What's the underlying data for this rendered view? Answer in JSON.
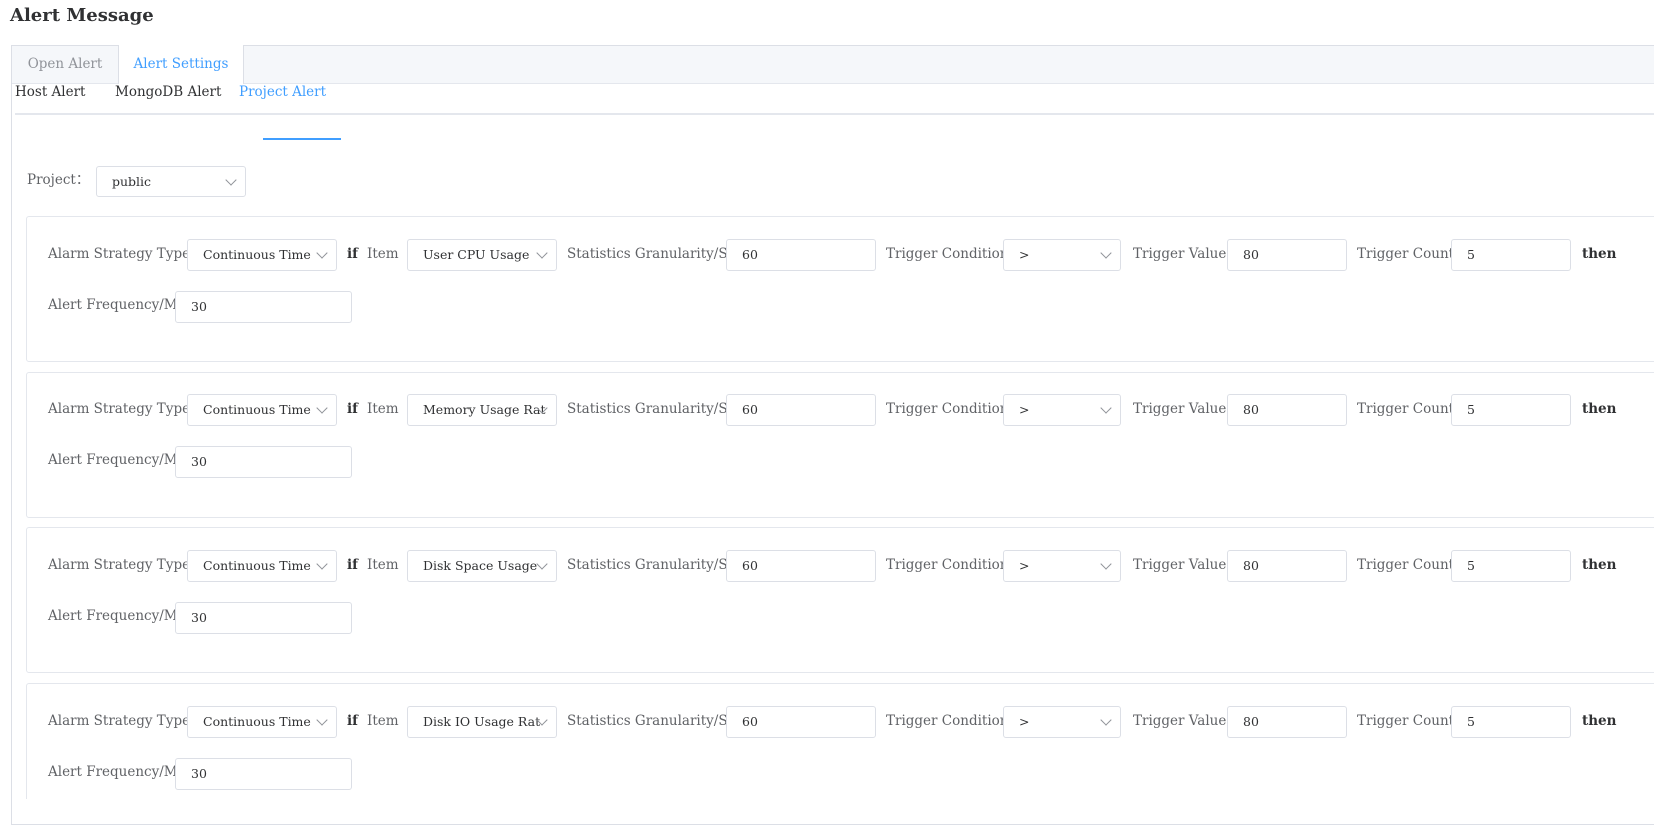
{
  "page": {
    "title": "Alert Message"
  },
  "outer_tabs": [
    {
      "label": "Open Alert",
      "active": false
    },
    {
      "label": "Alert Settings",
      "active": true
    }
  ],
  "inner_tabs": [
    {
      "label": "Host Alert",
      "active": false
    },
    {
      "label": "MongoDB Alert",
      "active": false
    },
    {
      "label": "Project Alert",
      "active": true
    }
  ],
  "project": {
    "label": "Project：",
    "value": "public"
  },
  "labels": {
    "strategy_type": "Alarm Strategy Type",
    "if": "if",
    "item": "Item",
    "granularity": "Statistics Granularity/S",
    "condition": "Trigger Condition",
    "value": "Trigger Value",
    "count": "Trigger Count",
    "then": "then",
    "frequency": "Alert Frequency/M"
  },
  "rules": [
    {
      "strategy": "Continuous Time",
      "item": "User CPU Usage",
      "granularity": "60",
      "condition": ">",
      "value": "80",
      "count": "5",
      "frequency": "30"
    },
    {
      "strategy": "Continuous Time",
      "item": "Memory Usage Rat",
      "granularity": "60",
      "condition": ">",
      "value": "80",
      "count": "5",
      "frequency": "30"
    },
    {
      "strategy": "Continuous Time",
      "item": "Disk Space Usage",
      "granularity": "60",
      "condition": ">",
      "value": "80",
      "count": "5",
      "frequency": "30"
    },
    {
      "strategy": "Continuous Time",
      "item": "Disk IO Usage Rat",
      "granularity": "60",
      "condition": ">",
      "value": "80",
      "count": "5",
      "frequency": "30"
    }
  ],
  "colors": {
    "accent": "#409eff",
    "border": "#dcdfe6",
    "tab_bg": "#f5f7fa"
  }
}
